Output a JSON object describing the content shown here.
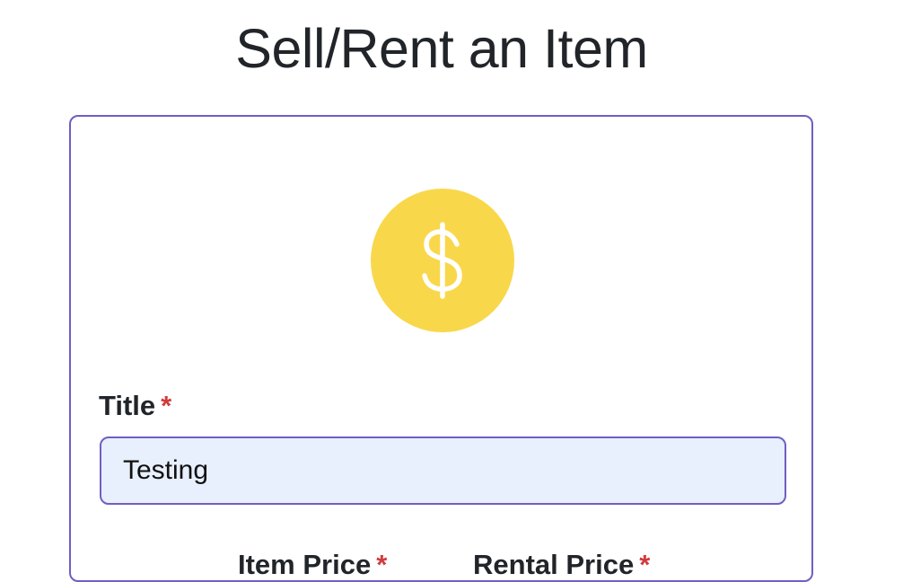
{
  "page": {
    "title": "Sell/Rent an Item"
  },
  "form": {
    "icon": "dollar-coin-icon",
    "icon_glyph": "$",
    "title_field": {
      "label": "Title",
      "required_marker": "*",
      "value": "Testing",
      "placeholder": ""
    },
    "price_fields": {
      "item_price_label": "Item Price",
      "rental_price_label": "Rental Price",
      "required_marker": "*"
    }
  },
  "colors": {
    "accent": "#6f5fc2",
    "coin": "#f8d84a",
    "input_bg": "#e8effd",
    "required": "#d13b3b",
    "text": "#212529"
  }
}
